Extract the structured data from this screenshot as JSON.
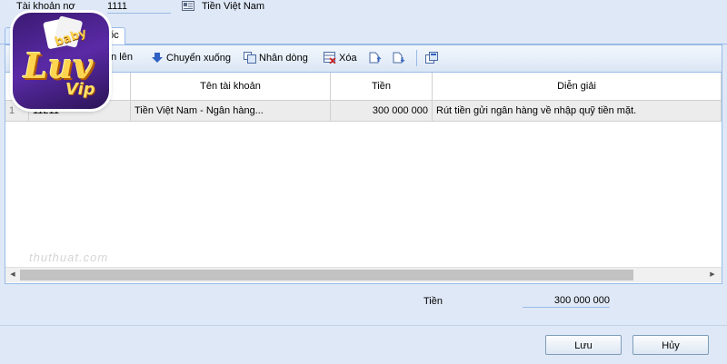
{
  "header": {
    "debit_account_label": "Tài khoản nợ",
    "debit_account_code": "1111",
    "debit_account_name": "Tiền Việt Nam"
  },
  "tabs": [
    {
      "label": "C"
    },
    {
      "label": "gốc"
    }
  ],
  "toolbar": {
    "move_up": "ển lên",
    "move_down": "Chuyển xuống",
    "duplicate": "Nhân dòng",
    "delete": "Xóa"
  },
  "grid": {
    "columns": [
      "Tên tài khoản",
      "Tiền",
      "Diễn giải"
    ],
    "rows": [
      {
        "index": "1",
        "account_code": "11211",
        "account_name": "Tiền Việt Nam - Ngân hàng...",
        "amount": "300 000 000",
        "description": "Rút tiền gửi ngân hàng về nhập quỹ tiền mặt."
      }
    ]
  },
  "watermark": "thuthuat.com",
  "totals": {
    "label": "Tiền",
    "value": "300 000 000"
  },
  "buttons": {
    "save": "Lưu",
    "cancel": "Hủy"
  },
  "logo": {
    "top": "baby",
    "main": "Luv",
    "bottom": "Vip"
  },
  "colors": {
    "border": "#99bbe8",
    "window_bg": "#dfe8f6",
    "selected_row": "#ececec"
  }
}
